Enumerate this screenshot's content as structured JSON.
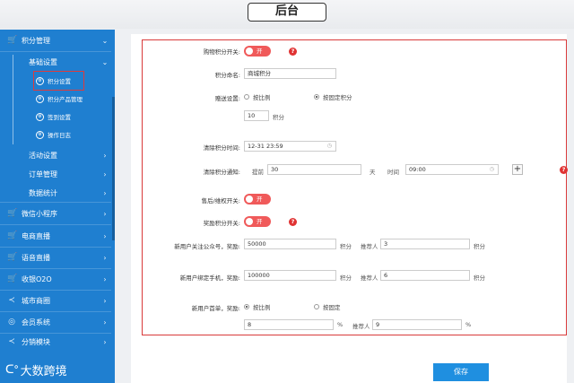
{
  "header": {
    "title": "后台"
  },
  "sidebar": {
    "items": [
      {
        "label": "积分管理",
        "icon": "cart-icon"
      },
      {
        "label": "基础设置"
      },
      {
        "label": "积分设置",
        "active": true
      },
      {
        "label": "积分产品管理"
      },
      {
        "label": "签到设置"
      },
      {
        "label": "操作日志"
      },
      {
        "label": "活动设置"
      },
      {
        "label": "订单管理"
      },
      {
        "label": "数据统计"
      },
      {
        "label": "微信小程序",
        "icon": "cart-icon"
      },
      {
        "label": "电商直播",
        "icon": "cart-icon"
      },
      {
        "label": "语音直播",
        "icon": "cart-icon"
      },
      {
        "label": "收银O2O",
        "icon": "cart-icon"
      },
      {
        "label": "城市商圈",
        "icon": "share-icon"
      },
      {
        "label": "会员系统",
        "icon": "member-icon"
      },
      {
        "label": "分销模块",
        "icon": "share-icon"
      }
    ],
    "logo_text": "大数跨境"
  },
  "form": {
    "shopping_switch_label": "购物积分开关:",
    "toggle_text": "开",
    "points_name_label": "积分命名:",
    "points_name_value": "商城积分",
    "gift_label": "赠送设置:",
    "gift_opt_ratio": "按比例",
    "gift_opt_fixed": "按固定积分",
    "gift_fixed_value": "10",
    "unit_points": "积分",
    "clear_time_label": "清除积分时间:",
    "clear_time_value": "12-31 23:59",
    "clear_notice_label": "清除积分通知:",
    "notice_prefix": "提前",
    "notice_days": "30",
    "unit_day": "天",
    "time_label": "时间",
    "notice_time": "09:00",
    "aftersale_label": "售后/维权开关:",
    "reward_switch_label": "奖励积分开关:",
    "follow_label": "新用户关注公众号，奖励:",
    "follow_value": "50000",
    "referrer_label": "推荐人",
    "follow_referrer_value": "3",
    "bind_phone_label": "新用户绑定手机，奖励:",
    "bind_phone_value": "100000",
    "bind_referrer_value": "6",
    "first_order_label": "新用户首单，奖励:",
    "first_opt_ratio": "按比例",
    "first_opt_fixed": "按固定",
    "first_order_value": "8",
    "unit_percent": "%",
    "first_referrer_value": "9",
    "help_mark": "?",
    "plus_mark": "+"
  },
  "actions": {
    "save_label": "保存"
  },
  "colors": {
    "sidebar": "#1f7fd0",
    "accent": "#f05a5a",
    "frame": "#d93a3a",
    "button": "#1f8fe0"
  }
}
